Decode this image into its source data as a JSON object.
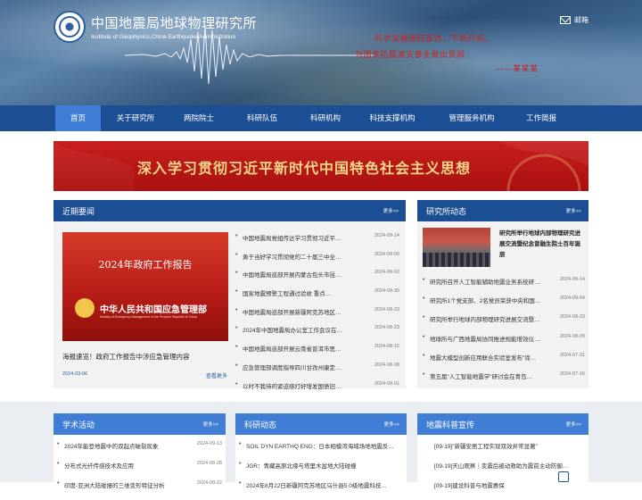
{
  "header": {
    "title_cn": "中国地震局地球物理研究所",
    "title_en": "Institute of Geophysics,China Earthquake Administration",
    "mail_label": "邮箱",
    "slogan_line1": "科学发展团结奋进，不断开拓，",
    "slogan_line2": "为国家防震减灾事业做出贡献",
    "slogan_line3": "——某某某"
  },
  "nav": {
    "items": [
      {
        "label": "首页",
        "active": true
      },
      {
        "label": "关于研究所"
      },
      {
        "label": "两院院士"
      },
      {
        "label": "科研队伍"
      },
      {
        "label": "科研机构"
      },
      {
        "label": "科技支撑机构"
      },
      {
        "label": "管理服务机构"
      },
      {
        "label": "工作简报"
      }
    ]
  },
  "banner": {
    "text": "深入学习贯彻习近平新时代中国特色社会主义思想"
  },
  "news": {
    "title": "近期要闻",
    "more": "更多>>",
    "feature": {
      "image_title": "2024年政府工作报告",
      "image_org": "中华人民共和国应急管理部",
      "image_org_en": "Ministry of Emergency Management of the People's Republic of China",
      "caption": "海报速览！政府工作报告中涉应急管理内容",
      "date": "2024-03-06",
      "more": "查看更多"
    },
    "items": [
      {
        "text": "中国地震局党组传达学习贯彻习近平…",
        "date": "2024-09-14"
      },
      {
        "text": "勇于当好学习贯彻党的二十届三中全…",
        "date": "2024-09-09"
      },
      {
        "text": "中国地震局巡部开展内蒙古包头市昆…",
        "date": "2024-09-02"
      },
      {
        "text": "国家地震预警工程通过验收 重点…",
        "date": "2024-08-30"
      },
      {
        "text": "中国地震局巡部开展新疆阿克苏地区…",
        "date": "2024-08-23"
      },
      {
        "text": "2024年中国地震局办公室工作会议在…",
        "date": "2024-08-23"
      },
      {
        "text": "中国地震局巡部开展云南省普洱市思…",
        "date": "2024-08-15"
      },
      {
        "text": "应急管理部调度指导四川甘孜州康定…",
        "date": "2024-08-08"
      },
      {
        "text": "以时不我待的紧迫感打好增发国债旧…",
        "date": "2024-08-01"
      }
    ]
  },
  "institute": {
    "title": "研究所动态",
    "more": "更多>>",
    "feature_caption": "研究所举行地球内部物理研究进展交流暨纪念曾融生院士百年诞辰",
    "items": [
      {
        "text": "研究所召开人工智能辅助地震业务系统研…",
        "date": "2024-09-14"
      },
      {
        "text": "研究所1个党支部、2名党员荣获中央和国…",
        "date": "2024-09-04"
      },
      {
        "text": "研究所举行地球内部物理研究进展交流暨…",
        "date": "2024-08-23"
      },
      {
        "text": "地球所与广西地震局协同推进规能增效仪…",
        "date": "2024-08-09"
      },
      {
        "text": "地震大模型创新应用联合实验室发布\"谛…",
        "date": "2024-07-31"
      },
      {
        "text": "第五届\"人工智能地震学\"研讨会在青岛…",
        "date": "2024-07-16"
      }
    ]
  },
  "academic": {
    "title": "学术活动",
    "more": "更多>>",
    "items": [
      {
        "text": "2024年能登地震中的双起点破裂现象",
        "date": "2024-09-13"
      },
      {
        "text": "分布式光纤传感技术及应用",
        "date": "2024-08-28"
      },
      {
        "text": "印度-亚洲大陆碰撞的三维变形特征分析",
        "date": "2024-08-22"
      }
    ]
  },
  "research": {
    "title": "科研动态",
    "more": "更多>>",
    "items": [
      {
        "text": "SOIL DYN EARTHQ ENG：日本相模湾海域场地地震反…"
      },
      {
        "text": "JGR：青藏高原北缘与塔里木盆地大陆碰撞"
      },
      {
        "text": "2024年8月22日新疆阿克苏地区乌什县5.0级地震科技…"
      }
    ]
  },
  "popsci": {
    "title": "地震科普宣传",
    "more": "更多>>",
    "items": [
      {
        "text": "[09-19]\"新疆安居工程实现双效并常显著\""
      },
      {
        "text": "[09-19]天山观察｜变震后被动救助为震前主动防御…"
      },
      {
        "text": "[09-19]建设科普与地震惠保"
      }
    ]
  }
}
